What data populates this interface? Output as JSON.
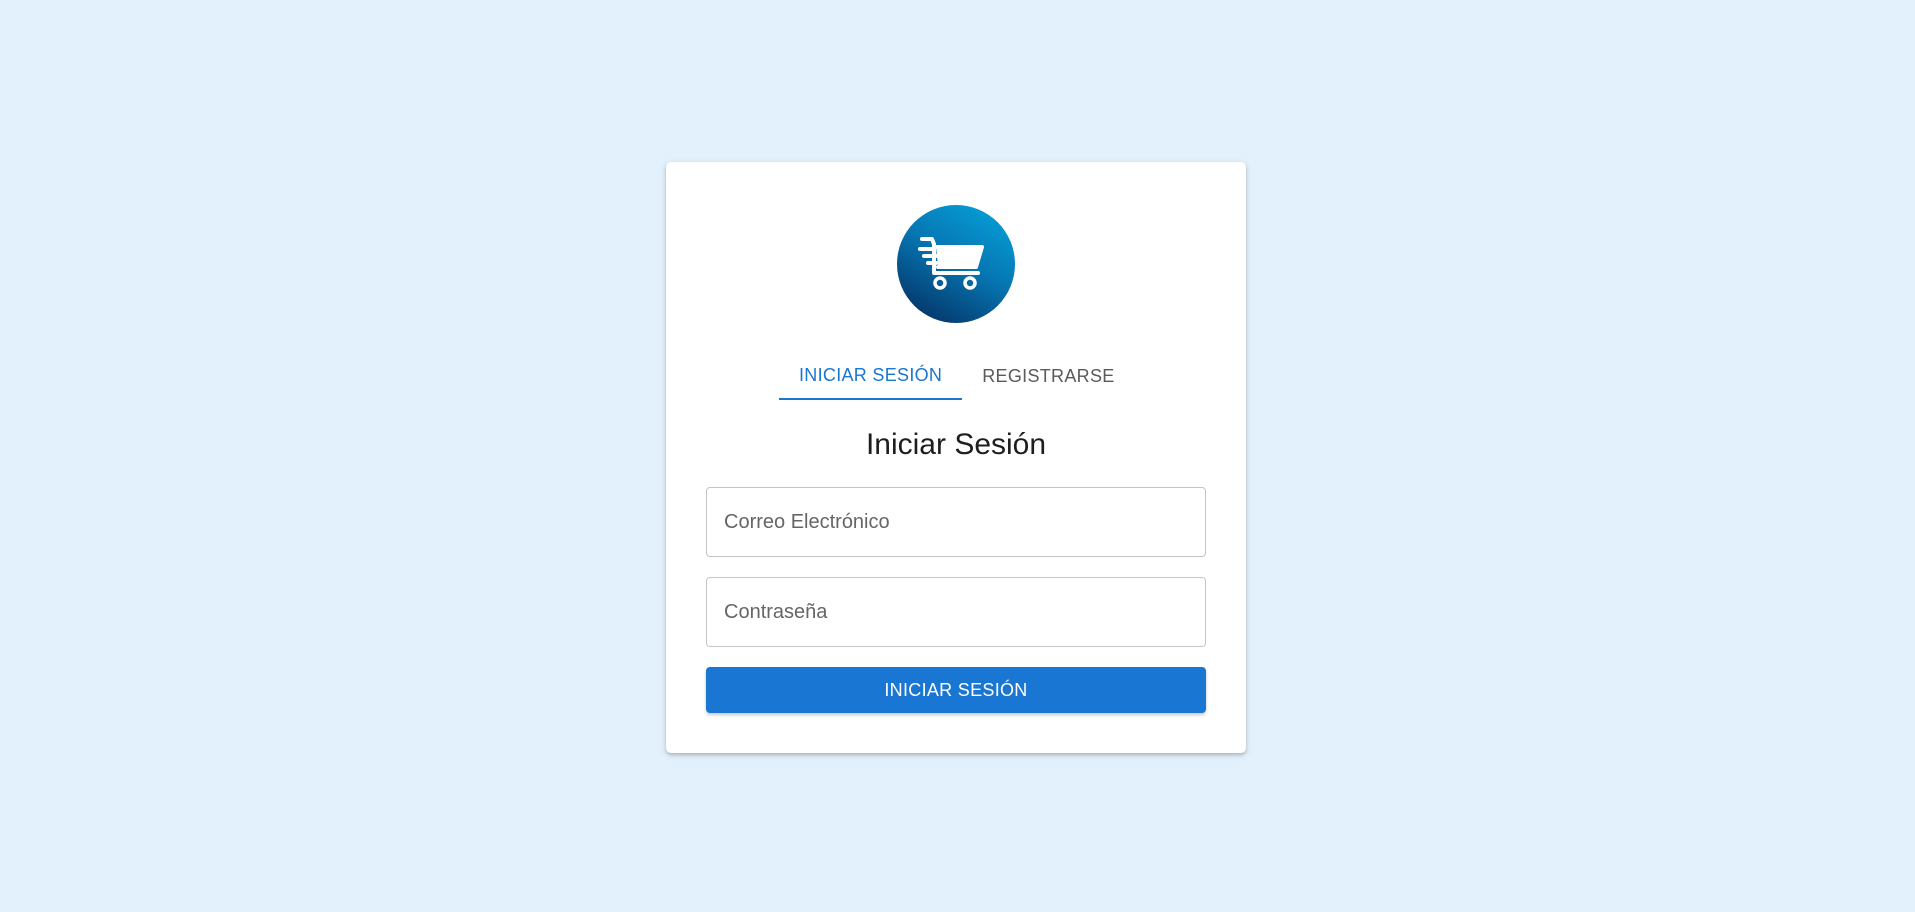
{
  "logo": {
    "icon": "shopping-cart-icon",
    "colors": [
      "#07a6de",
      "#0678b4",
      "#04285a"
    ]
  },
  "tabs": [
    {
      "label": "INICIAR SESIÓN",
      "active": true
    },
    {
      "label": "REGISTRARSE",
      "active": false
    }
  ],
  "form": {
    "title": "Iniciar Sesión",
    "email_placeholder": "Correo Electrónico",
    "email_value": "",
    "password_placeholder": "Contraseña",
    "password_value": "",
    "submit_label": "INICIAR SESIÓN"
  },
  "colors": {
    "accent": "#1976d2",
    "background": "#e3f1fc",
    "card": "#ffffff"
  }
}
